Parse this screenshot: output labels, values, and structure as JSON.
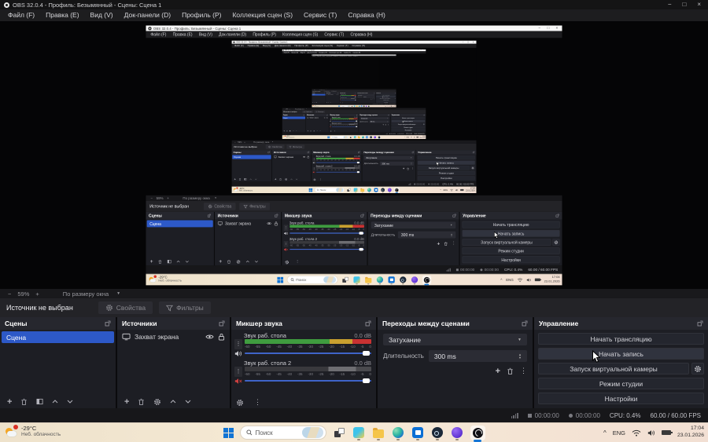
{
  "app": {
    "title": "OBS 32.0.4 - Профиль: Безымянный - Сцены: Сцена 1",
    "window_buttons": {
      "minimize": "−",
      "maximize": "□",
      "close": "×"
    }
  },
  "menu": {
    "items": [
      {
        "label": "Файл (F)"
      },
      {
        "label": "Правка (E)"
      },
      {
        "label": "Вид (V)"
      },
      {
        "label": "Док-панели (D)"
      },
      {
        "label": "Профиль (P)"
      },
      {
        "label": "Коллекция сцен (S)"
      },
      {
        "label": "Сервис (T)"
      },
      {
        "label": "Справка (H)"
      }
    ]
  },
  "zoombar": {
    "zoom_out": "−",
    "zoom_level": "59%",
    "zoom_in": "+",
    "fit_label": "По размеру окна"
  },
  "source_toolbar": {
    "status": "Источник не выбран",
    "properties_label": "Свойства",
    "filters_label": "Фильтры"
  },
  "scenes": {
    "title": "Сцены",
    "items": [
      {
        "name": "Сцена",
        "selected": true
      }
    ]
  },
  "sources": {
    "title": "Источники",
    "items": [
      {
        "name": "Захват экрана",
        "visible": true,
        "locked": true
      }
    ]
  },
  "mixer": {
    "title": "Микшер звука",
    "channels": [
      {
        "name": "Звук раб. стола",
        "level": "0.0 dB",
        "muted": false
      },
      {
        "name": "Звук раб. стола 2",
        "level": "0.0 dB",
        "muted": true
      }
    ],
    "scale_ticks": [
      "-60",
      "-55",
      "-50",
      "-45",
      "-40",
      "-35",
      "-30",
      "-25",
      "-20",
      "-15",
      "-10",
      "-5",
      "0"
    ]
  },
  "transitions": {
    "title": "Переходы между сценами",
    "current_transition": "Затухание",
    "duration_label": "Длительность",
    "duration_value": "300 ms"
  },
  "controls": {
    "title": "Управление",
    "buttons": [
      "Начать трансляцию",
      "Начать запись",
      "Запуск виртуальной камеры",
      "Режим студии",
      "Настройки"
    ]
  },
  "statusbar": {
    "stream_time": "00:00:00",
    "record_time": "00:00:00",
    "cpu": "CPU: 0.4%",
    "fps": "60.00 / 60.00 FPS"
  },
  "taskbar": {
    "weather": {
      "temperature": "-29°C",
      "condition": "Неб. облачность"
    },
    "search_placeholder": "Поиск",
    "tray": {
      "language": "ENG",
      "time": "17:04",
      "date": "23.01.2026"
    }
  },
  "colors": {
    "selection_accent": "#2d59c8",
    "meter_green": "#3f9c3f",
    "meter_yellow": "#c9a02f",
    "meter_red": "#c83232",
    "slider_blue": "#3f64c8",
    "taskbar_accent": "#1576d6",
    "mute_red": "#d04040"
  }
}
